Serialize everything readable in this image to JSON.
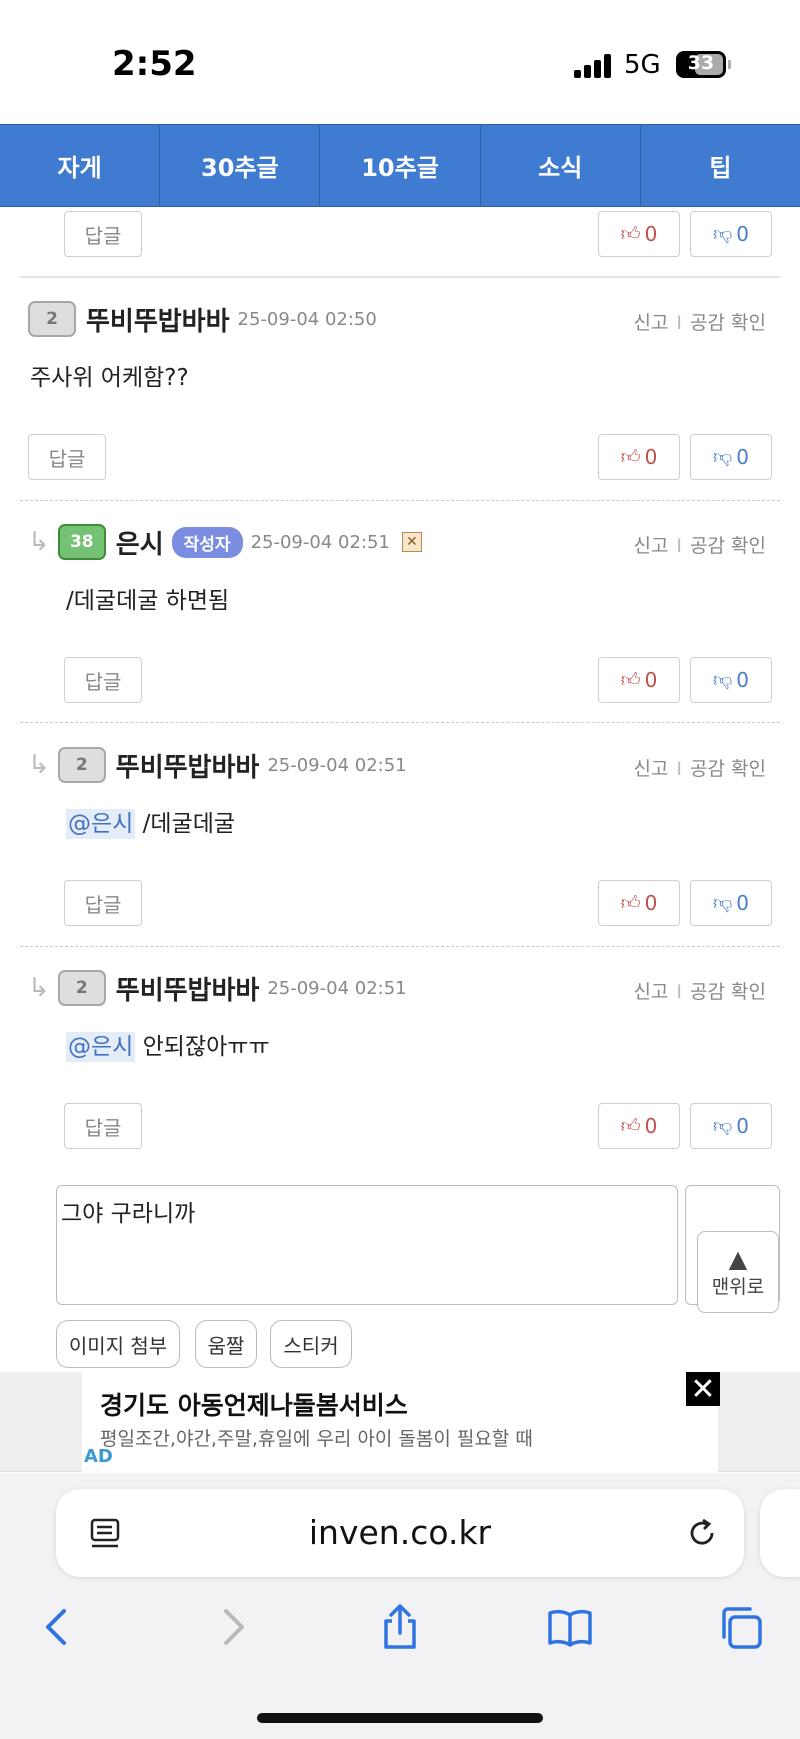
{
  "status": {
    "time": "2:52",
    "network": "5G",
    "battery": "33"
  },
  "tabs": [
    "자게",
    "30추글",
    "10추글",
    "소식",
    "팁"
  ],
  "common": {
    "reply_label": "답글",
    "report_label": "신고",
    "sep": "I",
    "empathy_label": "공감 확인"
  },
  "top_partial": {
    "up": "0",
    "down": "0"
  },
  "comments": [
    {
      "level": "2",
      "nick": "뚜비뚜밥바바",
      "date": "25-09-04 02:50",
      "text": "주사위 어케함??",
      "up": "0",
      "down": "0"
    },
    {
      "level": "38",
      "nick": "은시",
      "badge": "작성자",
      "date": "25-09-04 02:51",
      "text": "/데굴데굴 하면됨",
      "up": "0",
      "down": "0"
    },
    {
      "level": "2",
      "nick": "뚜비뚜밥바바",
      "date": "25-09-04 02:51",
      "mention": "@은시",
      "text": "/데굴데굴",
      "up": "0",
      "down": "0"
    },
    {
      "level": "2",
      "nick": "뚜비뚜밥바바",
      "date": "25-09-04 02:51",
      "mention": "@은시",
      "text": "안되잖아ㅠㅠ",
      "up": "0",
      "down": "0"
    }
  ],
  "write": {
    "value": "그야 구라니까",
    "top_label": "맨위로"
  },
  "attach": [
    "이미지 첨부",
    "움짤",
    "스티커"
  ],
  "ad": {
    "title": "경기도 아동언제나돌봄서비스",
    "desc": "평일조간,야간,주말,휴일에 우리 아이 돌봄이 필요할 때",
    "tag": "AD",
    "close": "✕"
  },
  "browser": {
    "url": "inven.co.kr"
  },
  "icons": {
    "thumb_up": "thumb-up-icon",
    "thumb_down": "thumb-down-icon",
    "reply_arrow": "reply-arrow-icon",
    "reader": "reader-icon",
    "reload": "reload-icon",
    "back": "back-icon",
    "forward": "forward-icon",
    "share": "share-icon",
    "bookmarks": "bookmarks-icon",
    "tabs": "tabs-icon"
  },
  "colors": {
    "tab_bar": "#3e7bd1",
    "vote_up": "#c0504d",
    "vote_down": "#4a7fc8",
    "author_badge": "#7b8de0",
    "mention": "#3f72c0"
  }
}
